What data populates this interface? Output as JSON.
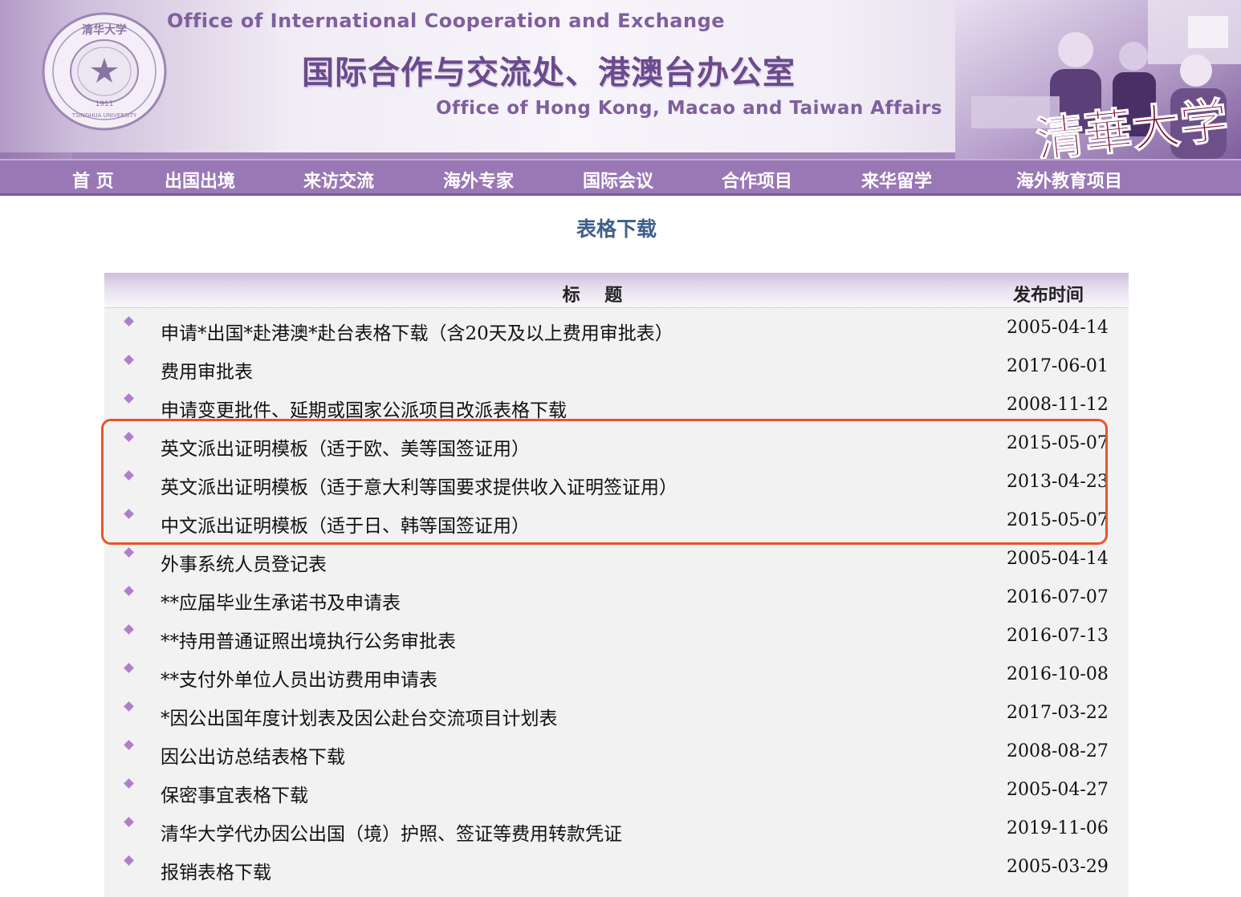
{
  "banner": {
    "title_en_top": "Office of International Cooperation and Exchange",
    "title_cn": "国际合作与交流处、港澳台办公室",
    "title_en_bottom": "Office of Hong Kong, Macao and Taiwan Affairs",
    "logo_icon": "tsinghua-seal-icon",
    "logo_text_top": "清华大学",
    "logo_text_en": "TSINGHUA UNIVERSITY",
    "logo_year": "1911",
    "calligraphy": "清華大学",
    "colors": {
      "banner_purple": "#a285ba",
      "title_purple": "#6b4a8d",
      "nav_purple": "#9a78b5"
    }
  },
  "nav": {
    "items": [
      {
        "label": "首 页"
      },
      {
        "label": "出国出境"
      },
      {
        "label": "来访交流"
      },
      {
        "label": "海外专家"
      },
      {
        "label": "国际会议"
      },
      {
        "label": "合作项目"
      },
      {
        "label": "来华留学"
      },
      {
        "label": "海外教育项目"
      }
    ]
  },
  "page": {
    "title": "表格下载"
  },
  "table": {
    "header_title": "标    题",
    "header_date": "发布时间",
    "bullet_icon": "diamond-bullet-icon",
    "bullet_color": "#b07fcb",
    "highlight_color": "#e8552b",
    "rows": [
      {
        "title": "申请*出国*赴港澳*赴台表格下载（含20天及以上费用审批表）",
        "date": "2005-04-14"
      },
      {
        "title": "费用审批表",
        "date": "2017-06-01"
      },
      {
        "title": "申请变更批件、延期或国家公派项目改派表格下载",
        "date": "2008-11-12"
      },
      {
        "title": "英文派出证明模板（适于欧、美等国签证用）",
        "date": "2015-05-07"
      },
      {
        "title": "英文派出证明模板（适于意大利等国要求提供收入证明签证用）",
        "date": "2013-04-23"
      },
      {
        "title": "中文派出证明模板（适于日、韩等国签证用）",
        "date": "2015-05-07"
      },
      {
        "title": "外事系统人员登记表",
        "date": "2005-04-14"
      },
      {
        "title": "**应届毕业生承诺书及申请表",
        "date": "2016-07-07"
      },
      {
        "title": "**持用普通证照出境执行公务审批表",
        "date": "2016-07-13"
      },
      {
        "title": "**支付外单位人员出访费用申请表",
        "date": "2016-10-08"
      },
      {
        "title": "*因公出国年度计划表及因公赴台交流项目计划表",
        "date": "2017-03-22"
      },
      {
        "title": "因公出访总结表格下载",
        "date": "2008-08-27"
      },
      {
        "title": "保密事宜表格下载",
        "date": "2005-04-27"
      },
      {
        "title": "清华大学代办因公出国（境）护照、签证等费用转款凭证",
        "date": "2019-11-06"
      },
      {
        "title": "报销表格下载",
        "date": "2005-03-29"
      }
    ]
  }
}
